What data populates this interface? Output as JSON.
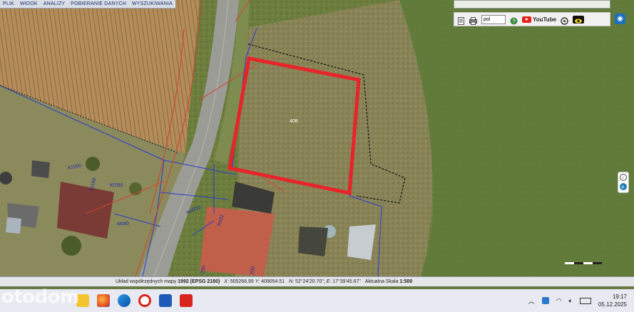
{
  "menu": [
    "PLIK",
    "WIDOK",
    "ANALIZY",
    "POBIERANIE DANYCH",
    "WYSZUKIWANIA"
  ],
  "toolbar": {
    "lang": "pol",
    "youtube": "YouTube"
  },
  "map_labels": {
    "ki160_a": "KI160",
    "ki160_b": "KI160",
    "ki160_c": "KI160",
    "wo40": "wo40",
    "wob32": "woB32",
    "wo32": "wo32",
    "plot": "408",
    "b200": "200",
    "b200b": "200"
  },
  "status": {
    "prefix": "Układ współrzędnych mapy",
    "crs": "1992 (EPSG 2180)",
    "x_label": "X:",
    "x_value": "505266.99",
    "y_label": "Y:",
    "y_value": "409054.51",
    "n_label": "N:",
    "n_value": "52°24'20.70\"",
    "e_label": "E:",
    "e_value": "17°39'45.67\"",
    "scale_label": "Aktualna Skala",
    "scale_value": "1:500"
  },
  "watermark": "otodom",
  "clock": {
    "time": "19:17",
    "date": "05.12.2025"
  },
  "colors": {
    "plot_outline": "#e8232a",
    "parcel_lines": "#2a3bd1",
    "field_fill": "#b08957"
  }
}
